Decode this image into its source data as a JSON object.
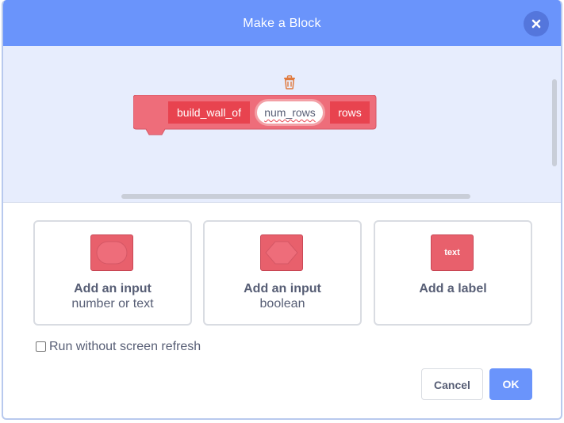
{
  "dialog": {
    "title": "Make a Block",
    "close_icon": "close-icon"
  },
  "workspace": {
    "trash_icon": "trash-icon",
    "block": {
      "label_name": "build_wall_of",
      "argument": "num_rows",
      "label_suffix": "rows",
      "color": "#e8434f"
    }
  },
  "options": [
    {
      "icon_name": "input-number-or-text-icon",
      "title": "Add an input",
      "subtitle": "number or text"
    },
    {
      "icon_name": "input-boolean-icon",
      "title": "Add an input",
      "subtitle": "boolean"
    },
    {
      "icon_name": "label-text-icon",
      "icon_text": "text",
      "title": "Add a label",
      "subtitle": ""
    }
  ],
  "checkbox": {
    "label": "Run without screen refresh",
    "checked": false
  },
  "buttons": {
    "cancel": "Cancel",
    "ok": "OK"
  },
  "colors": {
    "header": "#6a94fb",
    "workspace_bg": "#e7edfd",
    "block": "#e8434f",
    "text": "#575e75"
  }
}
